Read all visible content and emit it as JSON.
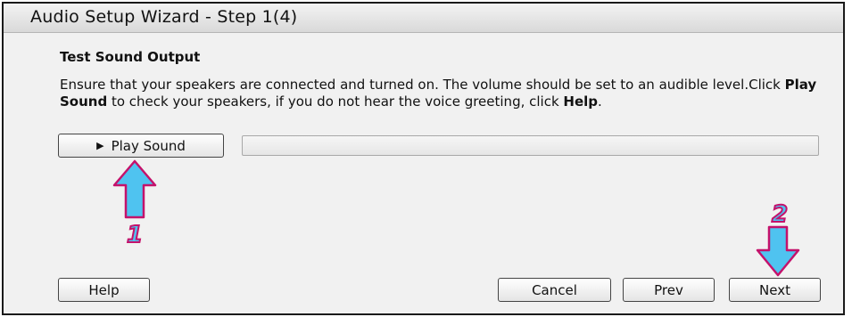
{
  "window": {
    "title": "Audio Setup Wizard - Step 1(4)"
  },
  "content": {
    "section_title": "Test Sound Output",
    "instructions": {
      "part1": "Ensure that your speakers are connected and turned on. The volume should be set to an audible level.Click ",
      "bold1": "Play Sound",
      "part2": " to check your speakers, if you do not hear the voice greeting, click ",
      "bold2": "Help",
      "part3": "."
    },
    "play_button_label": "Play Sound",
    "progress_fraction": 0
  },
  "buttons": {
    "help": "Help",
    "cancel": "Cancel",
    "prev": "Prev",
    "next": "Next"
  },
  "annotations": {
    "arrow1_number": "1",
    "arrow2_number": "2",
    "arrow_color": "#4fc3f0",
    "outline_color": "#c4126b"
  },
  "icons": {
    "play": "play-triangle-icon"
  }
}
